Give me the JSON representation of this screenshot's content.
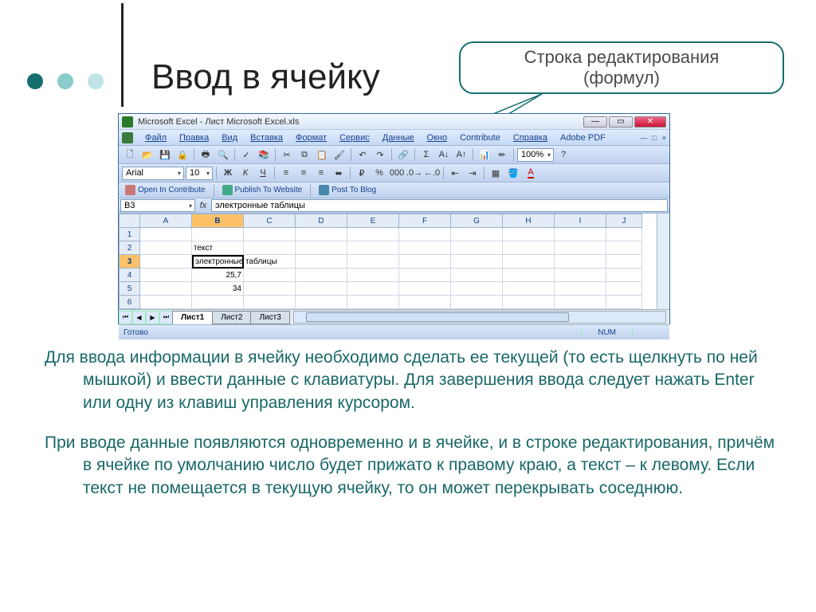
{
  "slide": {
    "title": "Ввод в ячейку",
    "callout": {
      "line1": "Строка редактирования",
      "line2": "(формул)"
    },
    "paragraph1": "Для ввода информации в ячейку необходимо сделать ее текущей (то есть щелкнуть по ней мышкой)  и ввести данные с клавиатуры. Для завершения ввода следует нажать Enter или одну из клавиш управления курсором.",
    "paragraph2": "При вводе данные появляются одновременно и в ячейке, и в строке редактирования, причём в ячейке по умолчанию число будет прижато к правому краю, а текст – к левому. Если текст не помещается в текущую ячейку, то он может перекрывать соседнюю."
  },
  "excel": {
    "title": "Microsoft Excel - Лист Microsoft Excel.xls",
    "menu": [
      "Файл",
      "Правка",
      "Вид",
      "Вставка",
      "Формат",
      "Сервис",
      "Данные",
      "Окно",
      "Contribute",
      "Справка",
      "Adobe PDF"
    ],
    "zoom": "100%",
    "font": "Arial",
    "fontsize": "10",
    "contribute": {
      "open": "Open In Contribute",
      "publish": "Publish To Website",
      "post": "Post To Blog"
    },
    "namebox": "B3",
    "fx": "fx",
    "formula": "электронные таблицы",
    "columns": [
      "A",
      "B",
      "C",
      "D",
      "E",
      "F",
      "G",
      "H",
      "I",
      "J"
    ],
    "rows": [
      "1",
      "2",
      "3",
      "4",
      "5",
      "6"
    ],
    "cells": {
      "b2": "текст",
      "b3": "электронные таблицы",
      "b4": "25,7",
      "b5": "34"
    },
    "sheets": [
      "Лист1",
      "Лист2",
      "Лист3"
    ],
    "status_ready": "Готово",
    "status_num": "NUM"
  }
}
